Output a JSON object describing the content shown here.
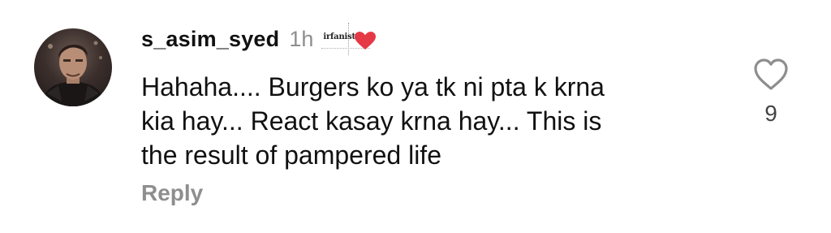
{
  "comment": {
    "username": "s_asim_syed",
    "time": "1h",
    "badge": {
      "text": "irfanist",
      "heart_color": "#e53945"
    },
    "text": "Hahaha.... Burgers ko ya tk ni pta k krna\nkia hay... React kasay krna hay... This is\nthe result of pampered life",
    "reply_label": "Reply",
    "like_icon": "heart-outline-icon",
    "like_count": "9"
  },
  "colors": {
    "primary_text": "#111111",
    "secondary_text": "#8e8e8e",
    "like_count_text": "#444444"
  }
}
